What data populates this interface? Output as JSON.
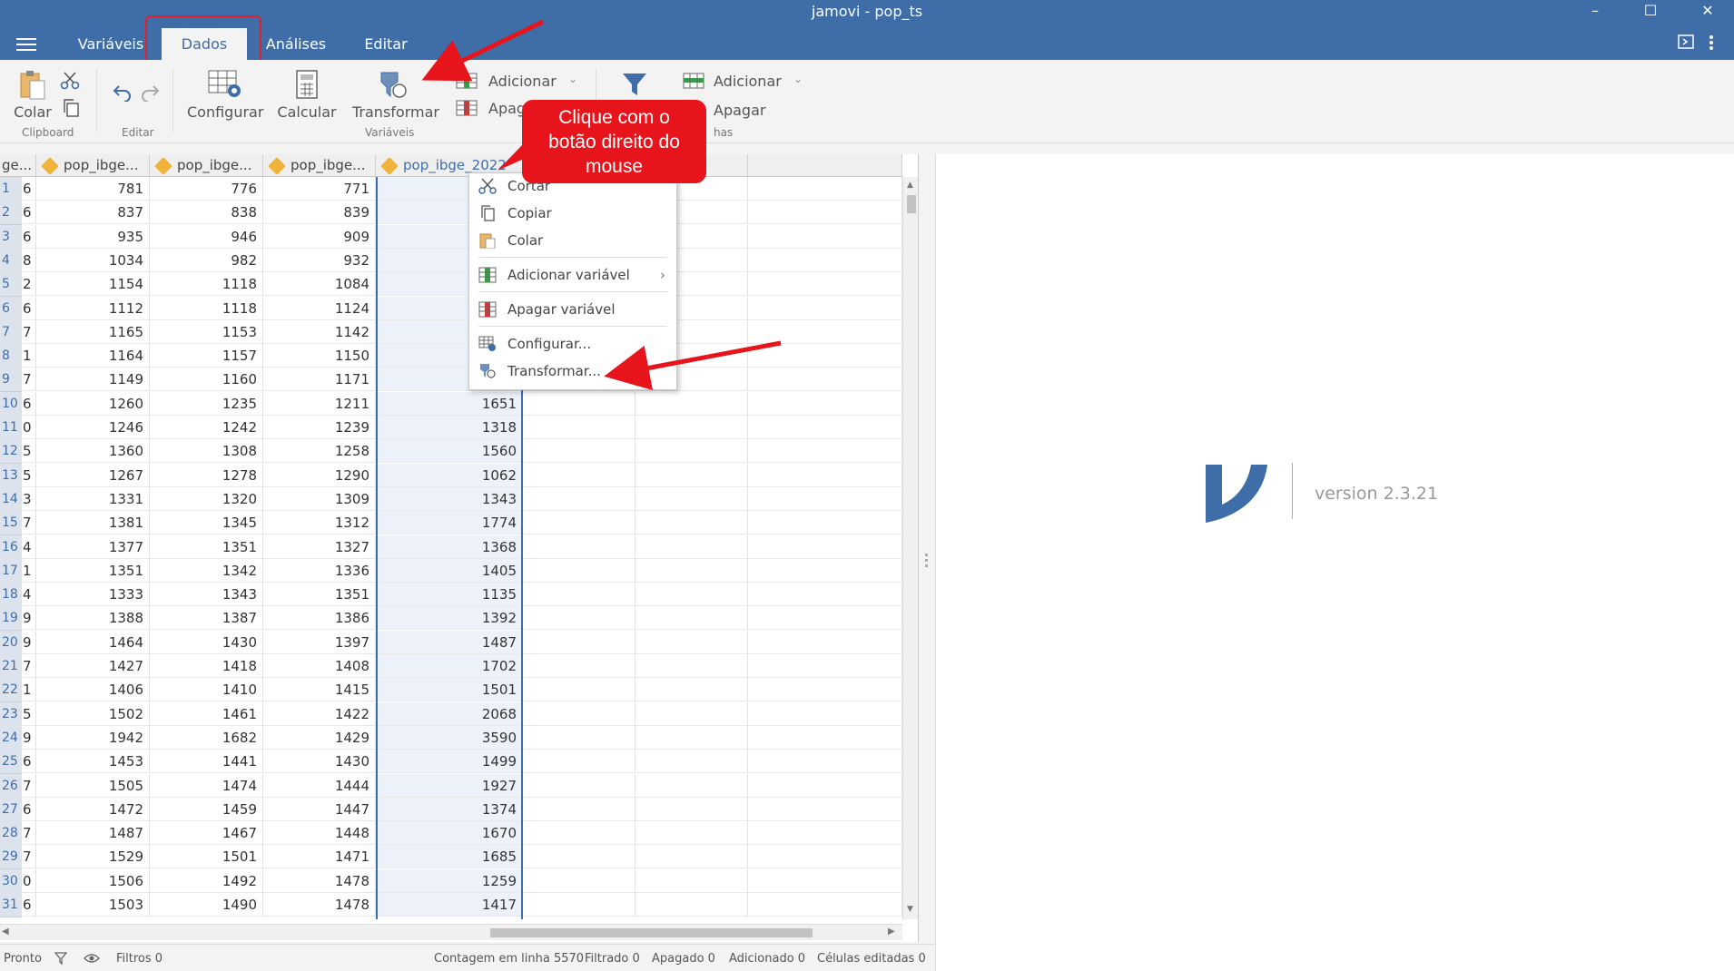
{
  "window": {
    "title": "jamovi - pop_ts",
    "minimize": "–",
    "maximize": "☐",
    "close": "✕"
  },
  "tabs": [
    {
      "label": "Variáveis"
    },
    {
      "label": "Dados"
    },
    {
      "label": "Análises"
    },
    {
      "label": "Editar"
    }
  ],
  "ribbon": {
    "colar": "Colar",
    "clipboard_group": "Clipboard",
    "editar_group": "Editar",
    "configurar": "Configurar",
    "calcular": "Calcular",
    "transformar": "Transformar",
    "variaveis_group": "Variáveis",
    "var_adicionar": "Adicionar",
    "var_apagar": "Apag",
    "row_adicionar": "Adicionar",
    "row_apagar": "Apagar",
    "linhas_group": "has"
  },
  "columns": [
    {
      "label": "ge..."
    },
    {
      "label": "pop_ibge..."
    },
    {
      "label": "pop_ibge..."
    },
    {
      "label": "pop_ibge..."
    },
    {
      "label": "pop_ibge_2022"
    }
  ],
  "rows": [
    {
      "n": "1",
      "c0": "6",
      "c1": "781",
      "c2": "776",
      "c3": "771",
      "c4": ""
    },
    {
      "n": "2",
      "c0": "6",
      "c1": "837",
      "c2": "838",
      "c3": "839",
      "c4": ""
    },
    {
      "n": "3",
      "c0": "6",
      "c1": "935",
      "c2": "946",
      "c3": "909",
      "c4": ""
    },
    {
      "n": "4",
      "c0": "8",
      "c1": "1034",
      "c2": "982",
      "c3": "932",
      "c4": ""
    },
    {
      "n": "5",
      "c0": "2",
      "c1": "1154",
      "c2": "1118",
      "c3": "1084",
      "c4": ""
    },
    {
      "n": "6",
      "c0": "6",
      "c1": "1112",
      "c2": "1118",
      "c3": "1124",
      "c4": ""
    },
    {
      "n": "7",
      "c0": "7",
      "c1": "1165",
      "c2": "1153",
      "c3": "1142",
      "c4": ""
    },
    {
      "n": "8",
      "c0": "1",
      "c1": "1164",
      "c2": "1157",
      "c3": "1150",
      "c4": ""
    },
    {
      "n": "9",
      "c0": "7",
      "c1": "1149",
      "c2": "1160",
      "c3": "1171",
      "c4": ""
    },
    {
      "n": "10",
      "c0": "6",
      "c1": "1260",
      "c2": "1235",
      "c3": "1211",
      "c4": "1651"
    },
    {
      "n": "11",
      "c0": "0",
      "c1": "1246",
      "c2": "1242",
      "c3": "1239",
      "c4": "1318"
    },
    {
      "n": "12",
      "c0": "5",
      "c1": "1360",
      "c2": "1308",
      "c3": "1258",
      "c4": "1560"
    },
    {
      "n": "13",
      "c0": "5",
      "c1": "1267",
      "c2": "1278",
      "c3": "1290",
      "c4": "1062"
    },
    {
      "n": "14",
      "c0": "3",
      "c1": "1331",
      "c2": "1320",
      "c3": "1309",
      "c4": "1343"
    },
    {
      "n": "15",
      "c0": "7",
      "c1": "1381",
      "c2": "1345",
      "c3": "1312",
      "c4": "1774"
    },
    {
      "n": "16",
      "c0": "4",
      "c1": "1377",
      "c2": "1351",
      "c3": "1327",
      "c4": "1368"
    },
    {
      "n": "17",
      "c0": "1",
      "c1": "1351",
      "c2": "1342",
      "c3": "1336",
      "c4": "1405"
    },
    {
      "n": "18",
      "c0": "4",
      "c1": "1333",
      "c2": "1343",
      "c3": "1351",
      "c4": "1135"
    },
    {
      "n": "19",
      "c0": "9",
      "c1": "1388",
      "c2": "1387",
      "c3": "1386",
      "c4": "1392"
    },
    {
      "n": "20",
      "c0": "9",
      "c1": "1464",
      "c2": "1430",
      "c3": "1397",
      "c4": "1487"
    },
    {
      "n": "21",
      "c0": "7",
      "c1": "1427",
      "c2": "1418",
      "c3": "1408",
      "c4": "1702"
    },
    {
      "n": "22",
      "c0": "1",
      "c1": "1406",
      "c2": "1410",
      "c3": "1415",
      "c4": "1501"
    },
    {
      "n": "23",
      "c0": "5",
      "c1": "1502",
      "c2": "1461",
      "c3": "1422",
      "c4": "2068"
    },
    {
      "n": "24",
      "c0": "9",
      "c1": "1942",
      "c2": "1682",
      "c3": "1429",
      "c4": "3590"
    },
    {
      "n": "25",
      "c0": "6",
      "c1": "1453",
      "c2": "1441",
      "c3": "1430",
      "c4": "1499"
    },
    {
      "n": "26",
      "c0": "7",
      "c1": "1505",
      "c2": "1474",
      "c3": "1444",
      "c4": "1927"
    },
    {
      "n": "27",
      "c0": "6",
      "c1": "1472",
      "c2": "1459",
      "c3": "1447",
      "c4": "1374"
    },
    {
      "n": "28",
      "c0": "7",
      "c1": "1487",
      "c2": "1467",
      "c3": "1448",
      "c4": "1670"
    },
    {
      "n": "29",
      "c0": "7",
      "c1": "1529",
      "c2": "1501",
      "c3": "1471",
      "c4": "1685"
    },
    {
      "n": "30",
      "c0": "0",
      "c1": "1506",
      "c2": "1492",
      "c3": "1478",
      "c4": "1259"
    },
    {
      "n": "31",
      "c0": "6",
      "c1": "1503",
      "c2": "1490",
      "c3": "1478",
      "c4": "1417"
    }
  ],
  "context_menu": [
    {
      "label": "Cortar",
      "icon": "scissors-icon"
    },
    {
      "label": "Copiar",
      "icon": "copy-icon"
    },
    {
      "label": "Colar",
      "icon": "paste-icon"
    },
    {
      "label": "Adicionar variável",
      "icon": "add-variable-icon",
      "submenu": "›"
    },
    {
      "label": "Apagar variável",
      "icon": "delete-variable-icon"
    },
    {
      "label": "Configurar...",
      "icon": "configure-icon"
    },
    {
      "label": "Transformar...",
      "icon": "transform-icon"
    }
  ],
  "callout": {
    "line1": "Clique com o",
    "line2": "botão direito do",
    "line3": "mouse"
  },
  "results": {
    "version": "version 2.3.21"
  },
  "status": {
    "ready": "Pronto",
    "filters": "Filtros 0",
    "row_count": "Contagem em linha 5570",
    "filtered": "Filtrado 0",
    "deleted": "Apagado 0",
    "added": "Adicionado 0",
    "edited": "Células editadas 0"
  },
  "colors": {
    "brand": "#3e6da8",
    "annotation": "#e8141c"
  }
}
